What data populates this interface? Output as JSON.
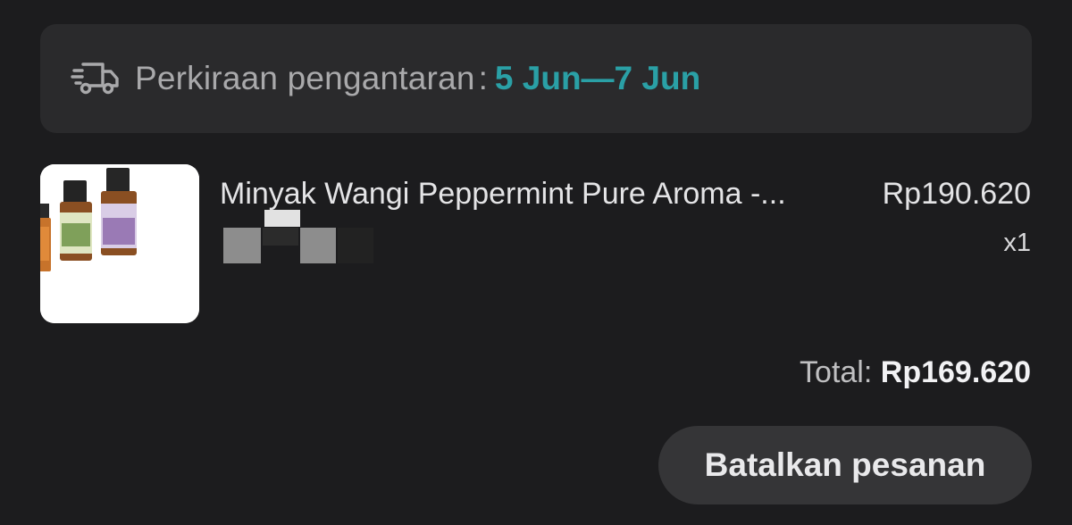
{
  "delivery": {
    "icon": "delivery-truck-icon",
    "label": "Perkiraan pengantaran",
    "separator": ":",
    "dates": "5 Jun—7 Jun",
    "accent_color": "#2aa0a6"
  },
  "product": {
    "name": "Minyak Wangi Peppermint Pure Aroma -...",
    "price": "Rp190.620",
    "quantity": "x1"
  },
  "order": {
    "total_label": "Total:",
    "total_value": "Rp169.620",
    "cancel_label": "Batalkan pesanan"
  }
}
